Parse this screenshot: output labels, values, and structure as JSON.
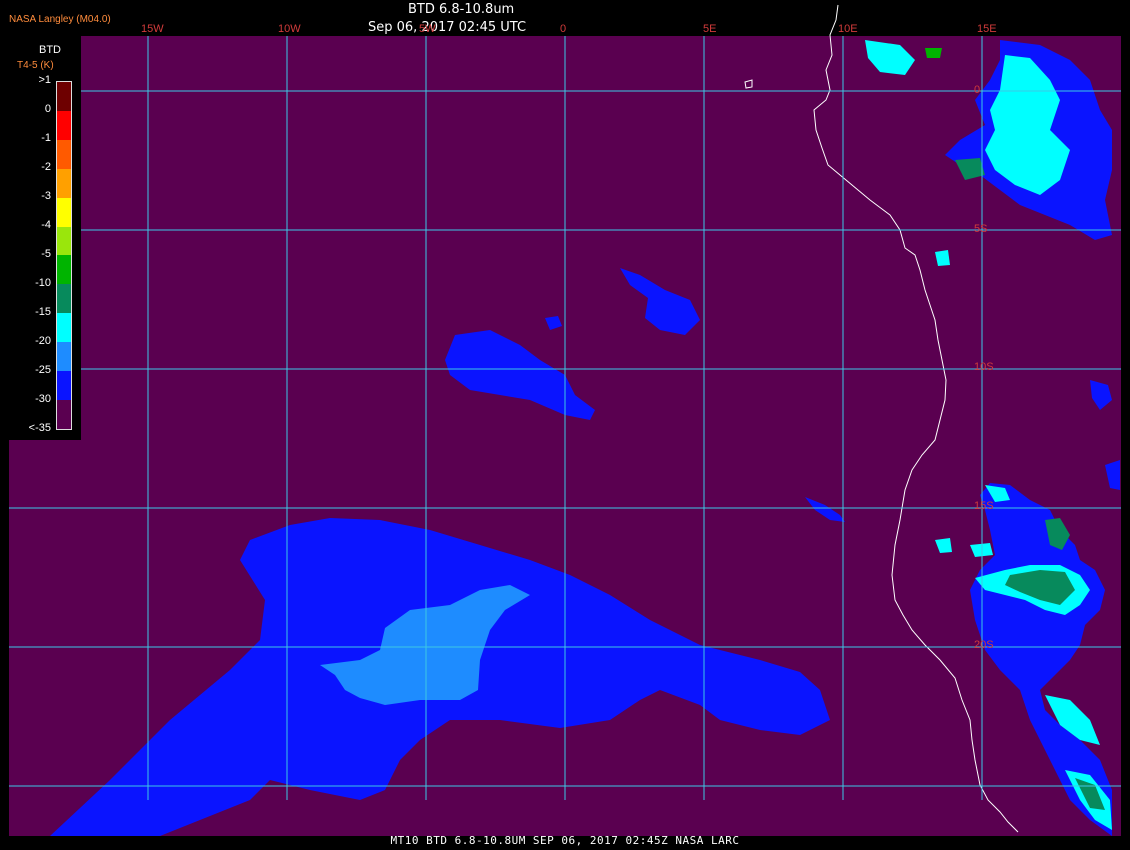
{
  "header": {
    "title": "BTD 6.8-10.8um",
    "subtitle": "Sep 06, 2017 02:45 UTC",
    "credit": "NASA Langley (M04.0)"
  },
  "footer": {
    "caption": "MT10  BTD 6.8-10.8UM   SEP 06, 2017 02:45Z   NASA LARC"
  },
  "legend": {
    "title": "BTD",
    "units": "T4-5 (K)",
    "ticks": [
      ">1",
      "0",
      "-1",
      "-2",
      "-3",
      "-4",
      "-5",
      "-10",
      "-15",
      "-20",
      "-25",
      "-30",
      "<-35"
    ],
    "colors": [
      "#6e0000",
      "#ff0000",
      "#ff5a00",
      "#ffa000",
      "#ffff00",
      "#9ae60c",
      "#00b400",
      "#078a5c",
      "#00ffff",
      "#1e8cff",
      "#0a14ff",
      "#5a0050"
    ]
  },
  "map": {
    "background_color": "#5a0050",
    "grid_color": "#3cc8e6",
    "coast_color": "#ffffff",
    "longitude_labels": [
      "15W",
      "10W",
      "5W",
      "0",
      "5E",
      "10E",
      "15E"
    ],
    "latitude_labels": [
      "0",
      "5S",
      "10S",
      "15S",
      "20S"
    ]
  }
}
